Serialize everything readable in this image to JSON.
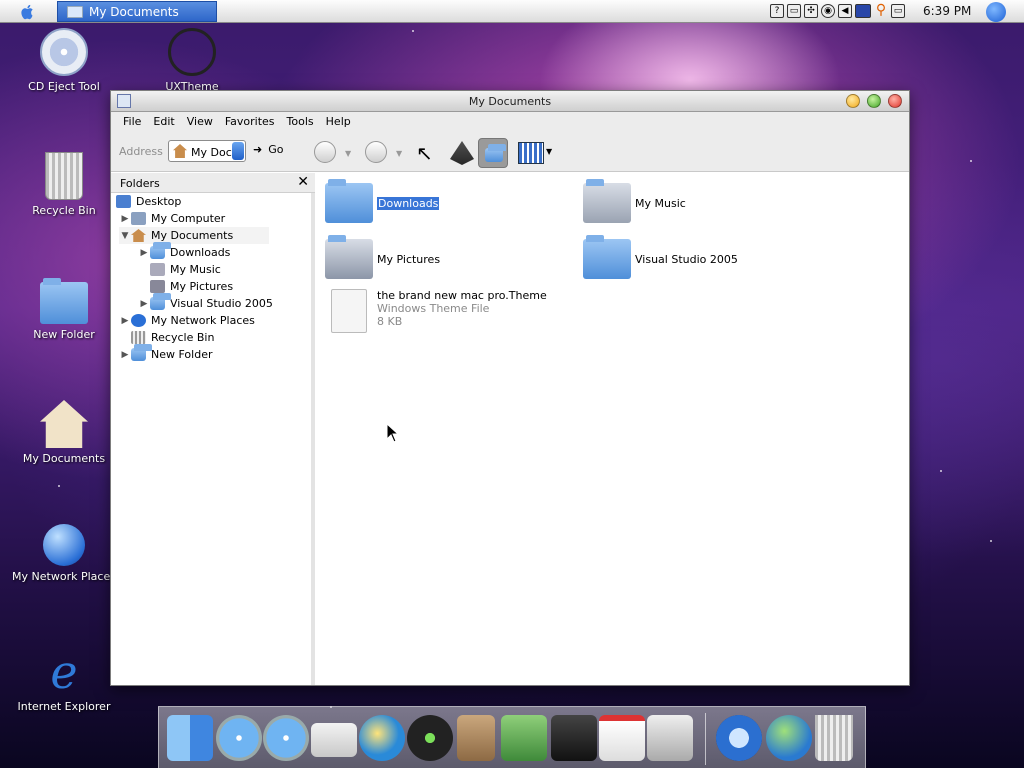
{
  "menubar": {
    "task_title": "My Documents",
    "clock": "6:39 PM",
    "tray_icons": [
      "help-icon",
      "battery-icon",
      "network-icon",
      "cd-icon",
      "volume-icon",
      "keyboard-icon",
      "search-magnifier-icon",
      "display-icon"
    ]
  },
  "desktop": {
    "icons": [
      {
        "label": "CD Eject Tool"
      },
      {
        "label": "UXTheme"
      },
      {
        "label": "Recycle Bin"
      },
      {
        "label": "New Folder"
      },
      {
        "label": "My Documents"
      },
      {
        "label": "My Network Places"
      },
      {
        "label": "Internet Explorer"
      }
    ]
  },
  "window": {
    "title": "My Documents",
    "menus": [
      "File",
      "Edit",
      "View",
      "Favorites",
      "Tools",
      "Help"
    ],
    "address_label": "Address",
    "address_value": "My Doc",
    "go_label": "Go",
    "folders_label": "Folders",
    "close_pane": "✕",
    "tree": [
      {
        "label": "Desktop"
      },
      {
        "label": "My Computer"
      },
      {
        "label": "My Documents"
      },
      {
        "label": "Downloads"
      },
      {
        "label": "My Music"
      },
      {
        "label": "My Pictures"
      },
      {
        "label": "Visual Studio 2005"
      },
      {
        "label": "My Network Places"
      },
      {
        "label": "Recycle Bin"
      },
      {
        "label": "New Folder"
      }
    ],
    "items": [
      {
        "name": "Downloads"
      },
      {
        "name": "My Music"
      },
      {
        "name": "My Pictures"
      },
      {
        "name": "Visual Studio 2005"
      },
      {
        "name": "the brand new mac pro.Theme",
        "type": "Windows Theme File",
        "size": "8 KB"
      }
    ]
  },
  "dock": {
    "icons": [
      "finder-icon",
      "safari-icon",
      "safari-alt-icon",
      "mail-icon",
      "ichat-icon",
      "itunes-icon",
      "address-book-icon",
      "iphoto-icon",
      "imovie-icon",
      "calendar-icon",
      "system-preferences-icon",
      "quicktime-icon",
      "network-globe-icon",
      "trash-icon"
    ]
  },
  "colors": {
    "selection": "#3875d7",
    "taskbar_button": "#2e66c9"
  }
}
